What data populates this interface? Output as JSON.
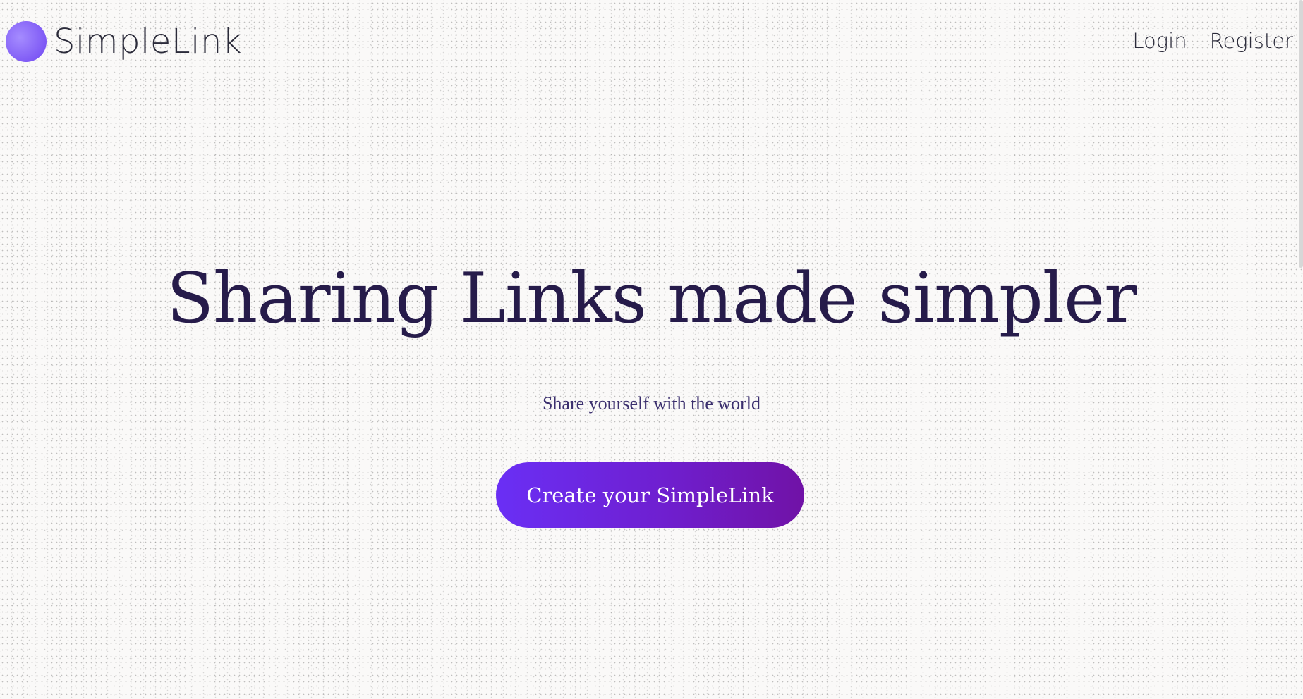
{
  "header": {
    "brand": "SimpleLink",
    "nav": [
      {
        "label": "Login"
      },
      {
        "label": "Register"
      }
    ]
  },
  "hero": {
    "title": "Sharing Links made simpler",
    "subtitle": "Share yourself with the world",
    "cta_label": "Create your SimpleLink"
  },
  "colors": {
    "accent_start": "#6a2ff5",
    "accent_end": "#7012a6",
    "title": "#261b4a",
    "background": "#faf9f8"
  },
  "icons": {
    "logo": "purple-circle-logo-icon"
  }
}
